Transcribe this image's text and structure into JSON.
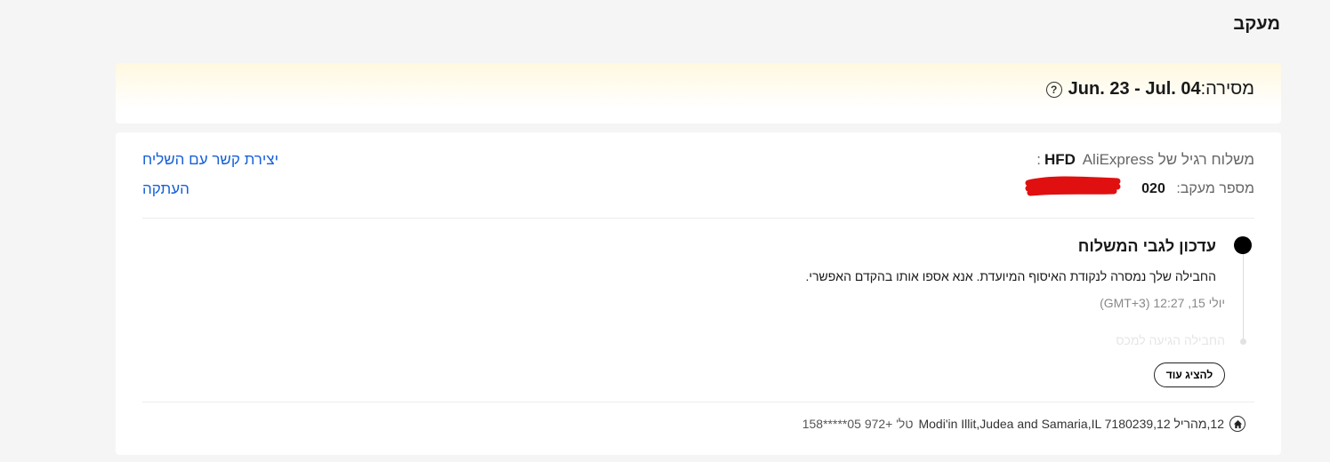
{
  "page": {
    "title": "מעקב"
  },
  "delivery": {
    "prefix": "מסירה:",
    "dates": "Jun. 23 - Jul. 04"
  },
  "shipment": {
    "method_label": "משלוח רגיל של",
    "carrier": "HFD",
    "provider": "AliExpress:",
    "tracking_label": "מספר מעקב:",
    "tracking_number": "020",
    "contact_courier_label": "יצירת קשר עם השליח",
    "copy_label": "העתקה"
  },
  "timeline": {
    "current": {
      "title": "עדכון לגבי המשלוח",
      "description": "החבילה שלך נמסרה לנקודת האיסוף המיועדת. אנא אספו אותו בהקדם האפשרי.",
      "time": "יולי 15, 12:27 (GMT+3)"
    },
    "next_preview": "החבילה הגיעה למכס",
    "show_more_label": "להציג עוד"
  },
  "address": {
    "text": "12,מהריל 12,Modi'in Illit,Judea and Samaria,IL 7180239",
    "phone": "+972 05*****158",
    "phone_prefix": "טל'"
  },
  "colors": {
    "link": "#1760d8",
    "redaction": "#e01010",
    "highlight": "#fff8e0"
  }
}
